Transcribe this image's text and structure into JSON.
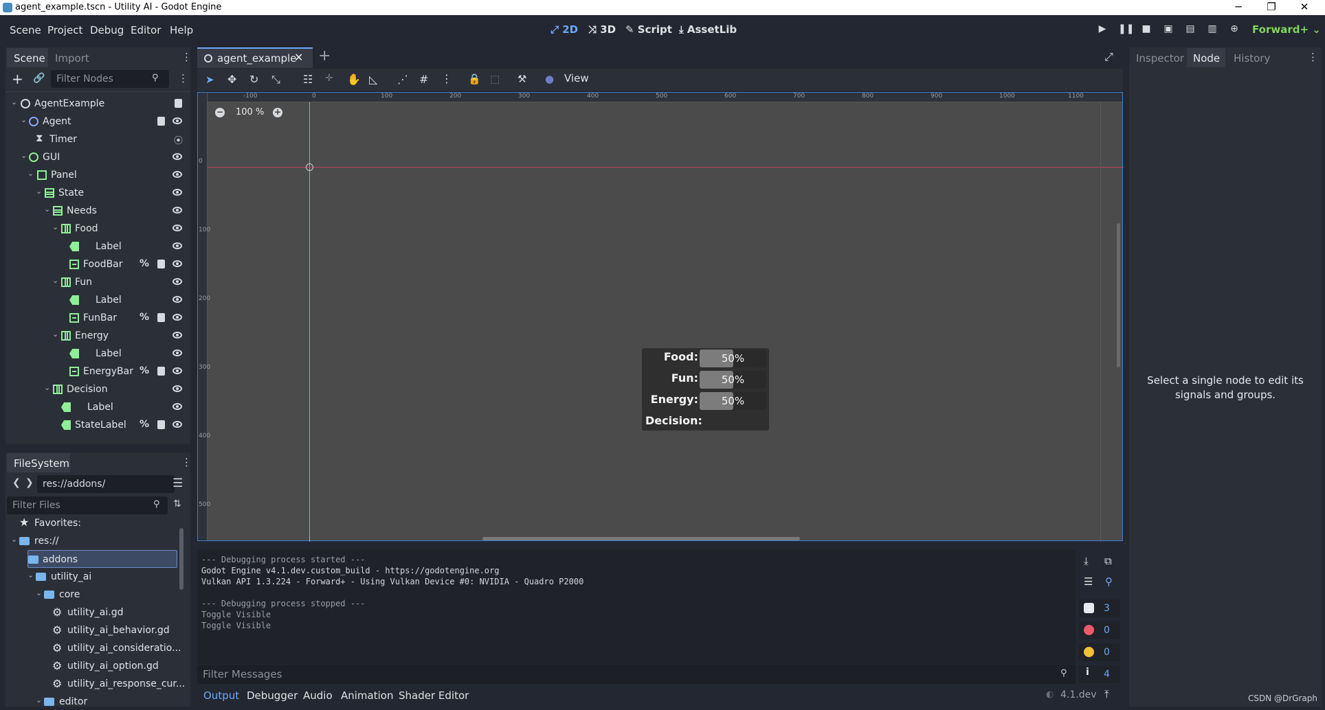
{
  "window": {
    "title": "agent_example.tscn - Utility AI - Godot Engine",
    "minimize": "─",
    "maximize": "❐",
    "close": "✕"
  },
  "menu": [
    "Scene",
    "Project",
    "Debug",
    "Editor",
    "Help"
  ],
  "modes": {
    "two_d": "2D",
    "three_d": "3D",
    "script": "Script",
    "assetlib": "AssetLib"
  },
  "renderer": "Forward+",
  "scene_dock": {
    "tabs": [
      "Scene",
      "Import"
    ],
    "filter_placeholder": "Filter Nodes",
    "nodes": [
      {
        "label": "AgentExample",
        "depth": 0,
        "icon": "node2d-icon"
      },
      {
        "label": "Agent",
        "depth": 1,
        "icon": "node-icon"
      },
      {
        "label": "Timer",
        "depth": 2,
        "icon": "timer-icon"
      },
      {
        "label": "GUI",
        "depth": 1,
        "icon": "control-icon"
      },
      {
        "label": "Panel",
        "depth": 2,
        "icon": "panel-icon"
      },
      {
        "label": "State",
        "depth": 3,
        "icon": "vbox-icon"
      },
      {
        "label": "Needs",
        "depth": 4,
        "icon": "vbox-icon"
      },
      {
        "label": "Food",
        "depth": 5,
        "icon": "hbox-icon"
      },
      {
        "label": "Label",
        "depth": 6,
        "icon": "label-icon"
      },
      {
        "label": "FoodBar",
        "depth": 6,
        "icon": "progressbar-icon"
      },
      {
        "label": "Fun",
        "depth": 5,
        "icon": "hbox-icon"
      },
      {
        "label": "Label",
        "depth": 6,
        "icon": "label-icon"
      },
      {
        "label": "FunBar",
        "depth": 6,
        "icon": "progressbar-icon"
      },
      {
        "label": "Energy",
        "depth": 5,
        "icon": "hbox-icon"
      },
      {
        "label": "Label",
        "depth": 6,
        "icon": "label-icon"
      },
      {
        "label": "EnergyBar",
        "depth": 6,
        "icon": "progressbar-icon"
      },
      {
        "label": "Decision",
        "depth": 4,
        "icon": "hbox-icon"
      },
      {
        "label": "Label",
        "depth": 5,
        "icon": "label-icon"
      },
      {
        "label": "StateLabel",
        "depth": 5,
        "icon": "label-icon"
      }
    ],
    "unique_marker": "%"
  },
  "filesystem": {
    "tab": "FileSystem",
    "path": "res://addons/",
    "filter_placeholder": "Filter Files",
    "items": [
      {
        "label": "Favorites:",
        "kind": "favorites"
      },
      {
        "label": "res://",
        "kind": "folder"
      },
      {
        "label": "addons",
        "kind": "folder"
      },
      {
        "label": "utility_ai",
        "kind": "folder"
      },
      {
        "label": "core",
        "kind": "folder"
      },
      {
        "label": "utility_ai.gd",
        "kind": "script"
      },
      {
        "label": "utility_ai_behavior.gd",
        "kind": "script"
      },
      {
        "label": "utility_ai_consideratio...",
        "kind": "script"
      },
      {
        "label": "utility_ai_option.gd",
        "kind": "script"
      },
      {
        "label": "utility_ai_response_cur...",
        "kind": "script"
      },
      {
        "label": "editor",
        "kind": "folder"
      }
    ]
  },
  "editor": {
    "scene_tab": "agent_example",
    "view_menu": "View",
    "zoom": "100 %",
    "ruler_h": [
      "-100",
      "0",
      "100",
      "200",
      "300",
      "400",
      "500",
      "600",
      "700",
      "800",
      "900",
      "1000",
      "1100"
    ],
    "ruler_v": [
      "0",
      "100",
      "200",
      "300",
      "400",
      "500"
    ]
  },
  "gui_preview": {
    "rows": [
      {
        "label": "Food:",
        "value": "50%",
        "fraction": 0.5
      },
      {
        "label": "Fun:",
        "value": "50%",
        "fraction": 0.5
      },
      {
        "label": "Energy:",
        "value": "50%",
        "fraction": 0.5
      }
    ],
    "decision_label": "Decision:"
  },
  "right_dock": {
    "tabs": [
      "Inspector",
      "Node",
      "History"
    ],
    "message": "Select a single node to edit its signals and groups."
  },
  "output": {
    "lines": [
      "--- Debugging process started ---",
      "Godot Engine v4.1.dev.custom_build - https://godotengine.org",
      "Vulkan API 1.3.224 - Forward+ - Using Vulkan Device #0: NVIDIA - Quadro P2000",
      "",
      "--- Debugging process stopped ---",
      "Toggle Visible",
      "Toggle Visible"
    ],
    "filter_placeholder": "Filter Messages",
    "counts": {
      "messages": "3",
      "errors": "0",
      "warnings": "0",
      "info": "4"
    }
  },
  "bottom_tabs": [
    "Output",
    "Debugger",
    "Audio",
    "Animation",
    "Shader Editor"
  ],
  "version": "4.1.dev",
  "watermark": "CSDN @DrGraph",
  "colors": {
    "accent": "#6aa8f7",
    "green": "#8eef97",
    "renderer": "#7fd45f"
  }
}
